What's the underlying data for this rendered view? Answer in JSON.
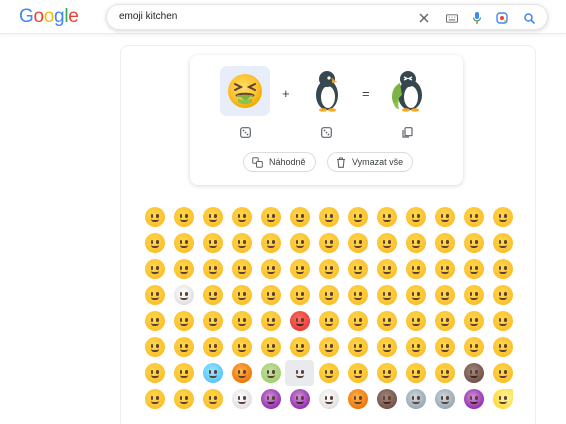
{
  "header": {
    "logo_letters": [
      {
        "ch": "G",
        "color": "#4285F4"
      },
      {
        "ch": "o",
        "color": "#EA4335"
      },
      {
        "ch": "o",
        "color": "#FBBC05"
      },
      {
        "ch": "g",
        "color": "#4285F4"
      },
      {
        "ch": "l",
        "color": "#34A853"
      },
      {
        "ch": "e",
        "color": "#EA4335"
      }
    ],
    "search_query": "emoji kitchen",
    "icons": [
      "clear-icon",
      "keyboard-icon",
      "microphone-icon",
      "lens-icon",
      "search-icon"
    ]
  },
  "kitchen": {
    "plus_symbol": "+",
    "equals_symbol": "=",
    "slots": [
      {
        "name": "nauseated-face",
        "selected": true
      },
      {
        "name": "penguin",
        "selected": false
      },
      {
        "name": "penguin-nauseated-mashup",
        "selected": false
      }
    ],
    "random_button_label": "Náhodně",
    "clear_button_label": "Vymazat vše"
  },
  "emoji_grid": {
    "rows": [
      [
        "yellow",
        "yellow",
        "yellow",
        "yellow",
        "yellow",
        "yellow",
        "yellow",
        "yellow",
        "yellow",
        "yellow",
        "yellow",
        "yellow",
        "yellow"
      ],
      [
        "yellow",
        "yellow",
        "yellow",
        "yellow",
        "yellow",
        "yellow",
        "yellow",
        "yellow",
        "yellow",
        "yellow",
        "yellow",
        "yellow",
        "yellow"
      ],
      [
        "yellow",
        "yellow",
        "yellow",
        "yellow",
        "yellow",
        "yellow",
        "yellow",
        "yellow",
        "yellow",
        "yellow",
        "yellow",
        "yellow",
        "yellow"
      ],
      [
        "yellow",
        "white",
        "yellow",
        "yellow",
        "yellow",
        "yellow",
        "yellow",
        "yellow",
        "yellow",
        "yellow",
        "yellow",
        "yellow",
        "yellow"
      ],
      [
        "yellow",
        "yellow",
        "yellow",
        "yellow",
        "yellow",
        "red",
        "yellow",
        "yellow",
        "yellow",
        "yellow",
        "yellow",
        "yellow",
        "yellow"
      ],
      [
        "yellow",
        "yellow",
        "yellow",
        "yellow",
        "yellow",
        "yellow",
        "yellow",
        "yellow",
        "yellow",
        "yellow",
        "yellow",
        "yellow",
        "yellow"
      ],
      [
        "yellow",
        "yellow",
        "blue",
        "orange",
        "green",
        "yellow",
        "yellow",
        "yellow",
        "yellow",
        "yellow",
        "yellow",
        "brown",
        "yellow"
      ],
      [
        "yellow",
        "yellow",
        "yellow",
        "white",
        "purple",
        "purple",
        "white",
        "orange",
        "brown",
        "gray",
        "gray",
        "purple",
        "moon"
      ]
    ],
    "highlighted_cell": {
      "row": 6,
      "col": 5
    }
  }
}
